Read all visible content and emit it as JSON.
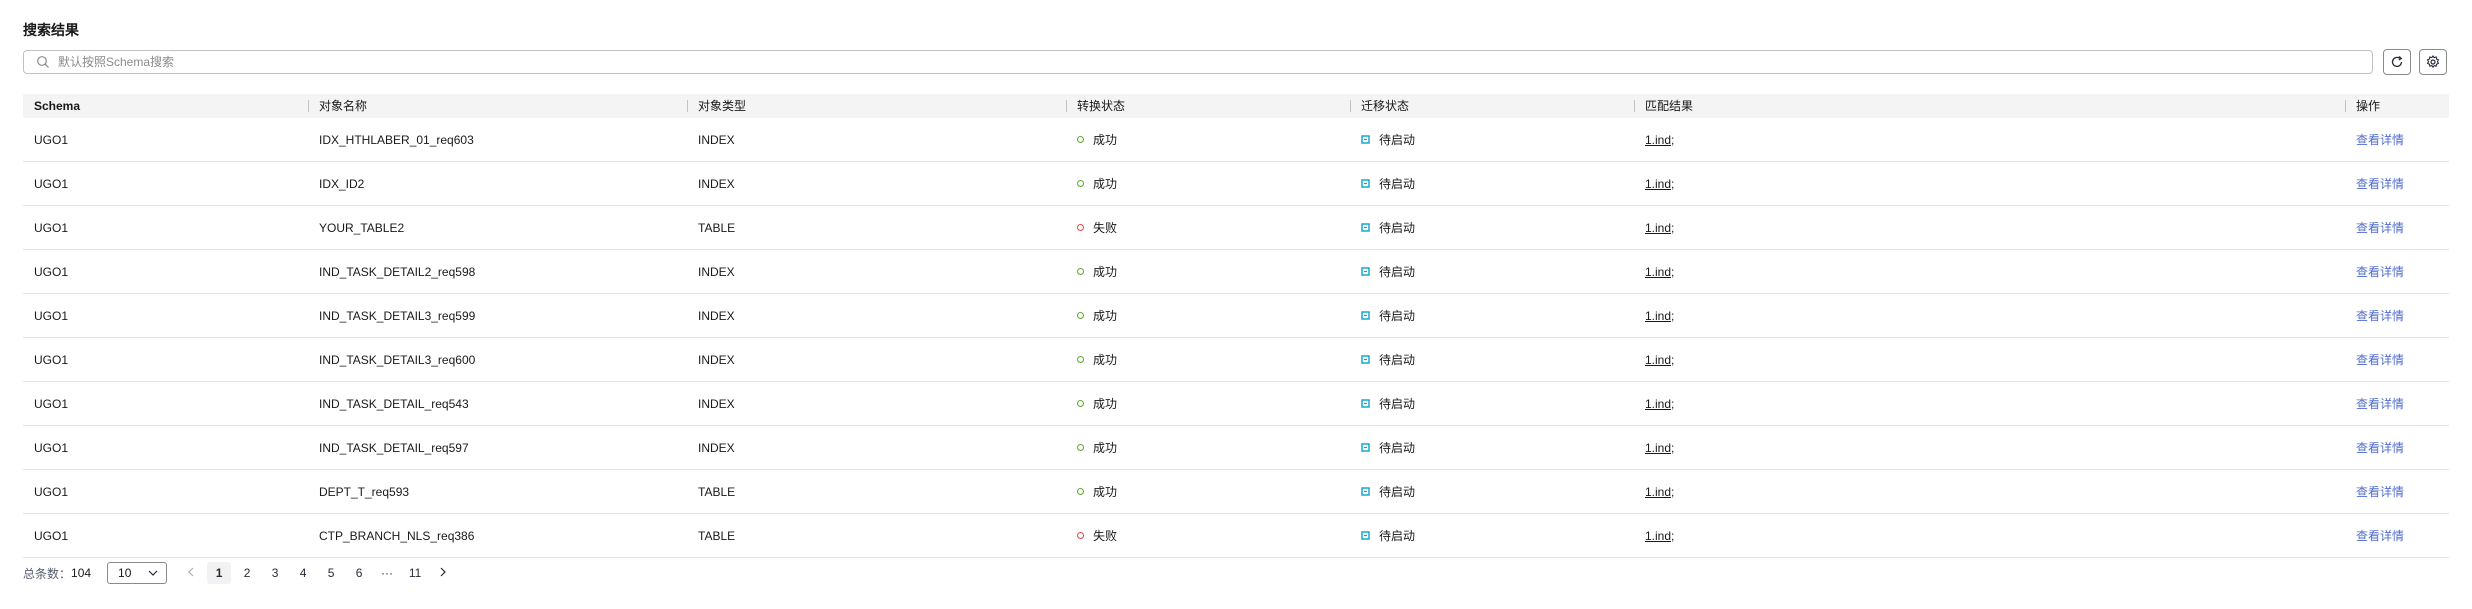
{
  "section_title": "搜索结果",
  "search": {
    "placeholder": "默认按照Schema搜索",
    "value": ""
  },
  "table": {
    "headers": [
      "Schema",
      "对象名称",
      "对象类型",
      "转换状态",
      "迁移状态",
      "匹配结果",
      "操作"
    ],
    "rows": [
      {
        "schema": "UGO1",
        "name": "IDX_HTHLABER_01_req603",
        "type": "INDEX",
        "conv": "成功",
        "conv_ok": true,
        "mig": "待启动",
        "match": "1.ind;",
        "action": "查看详情"
      },
      {
        "schema": "UGO1",
        "name": "IDX_ID2",
        "type": "INDEX",
        "conv": "成功",
        "conv_ok": true,
        "mig": "待启动",
        "match": "1.ind;",
        "action": "查看详情"
      },
      {
        "schema": "UGO1",
        "name": "YOUR_TABLE2",
        "type": "TABLE",
        "conv": "失败",
        "conv_ok": false,
        "mig": "待启动",
        "match": "1.ind;",
        "action": "查看详情"
      },
      {
        "schema": "UGO1",
        "name": "IND_TASK_DETAIL2_req598",
        "type": "INDEX",
        "conv": "成功",
        "conv_ok": true,
        "mig": "待启动",
        "match": "1.ind;",
        "action": "查看详情"
      },
      {
        "schema": "UGO1",
        "name": "IND_TASK_DETAIL3_req599",
        "type": "INDEX",
        "conv": "成功",
        "conv_ok": true,
        "mig": "待启动",
        "match": "1.ind;",
        "action": "查看详情"
      },
      {
        "schema": "UGO1",
        "name": "IND_TASK_DETAIL3_req600",
        "type": "INDEX",
        "conv": "成功",
        "conv_ok": true,
        "mig": "待启动",
        "match": "1.ind;",
        "action": "查看详情"
      },
      {
        "schema": "UGO1",
        "name": "IND_TASK_DETAIL_req543",
        "type": "INDEX",
        "conv": "成功",
        "conv_ok": true,
        "mig": "待启动",
        "match": "1.ind;",
        "action": "查看详情"
      },
      {
        "schema": "UGO1",
        "name": "IND_TASK_DETAIL_req597",
        "type": "INDEX",
        "conv": "成功",
        "conv_ok": true,
        "mig": "待启动",
        "match": "1.ind;",
        "action": "查看详情"
      },
      {
        "schema": "UGO1",
        "name": "DEPT_T_req593",
        "type": "TABLE",
        "conv": "成功",
        "conv_ok": true,
        "mig": "待启动",
        "match": "1.ind;",
        "action": "查看详情"
      },
      {
        "schema": "UGO1",
        "name": "CTP_BRANCH_NLS_req386",
        "type": "TABLE",
        "conv": "失败",
        "conv_ok": false,
        "mig": "待启动",
        "match": "1.ind;",
        "action": "查看详情"
      }
    ]
  },
  "pagination": {
    "total_label": "总条数：",
    "total": "104",
    "page_size": "10",
    "pages": [
      "1",
      "2",
      "3",
      "4",
      "5",
      "6",
      "···",
      "11"
    ],
    "current": "1"
  },
  "icons": {
    "search": "search-icon",
    "refresh": "refresh-icon",
    "settings": "settings-icon",
    "success": "success-status-icon",
    "fail": "fail-status-icon",
    "pending": "pending-migration-icon"
  },
  "colors": {
    "success": "#5aab2e",
    "fail": "#e54545",
    "pending": "#0ba2c9",
    "link": "#526ecc"
  }
}
